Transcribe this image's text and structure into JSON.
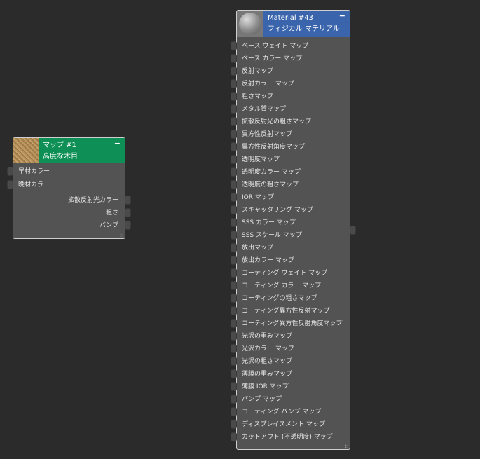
{
  "map_node": {
    "title": "マップ #1",
    "subtitle": "高度な木目",
    "color": "#0e8f55",
    "inputs": [
      "早材カラー",
      "晩材カラー"
    ],
    "outputs": [
      "拡散反射光カラー",
      "粗さ",
      "バンプ"
    ]
  },
  "material_node": {
    "title": "Material #43",
    "subtitle": "フィジカル マテリアル",
    "color": "#3a64ab",
    "inputs": [
      "ベース ウェイト マップ",
      "ベース カラー マップ",
      "反射マップ",
      "反射カラー マップ",
      "粗さマップ",
      "メタル質マップ",
      "拡散反射光の粗さマップ",
      "異方性反射マップ",
      "異方性反射角度マップ",
      "透明度マップ",
      "透明度カラー マップ",
      "透明度の粗さマップ",
      "IOR マップ",
      "スキャッタリング マップ",
      "SSS カラー マップ",
      "SSS スケール マップ",
      "放出マップ",
      "放出カラー マップ",
      "コーティング ウェイト マップ",
      "コーティング カラー マップ",
      "コーティングの粗さマップ",
      "コーティング異方性反射マップ",
      "コーティング異方性反射角度マップ",
      "光沢の重みマップ",
      "光沢カラー マップ",
      "光沢の粗さマップ",
      "薄膜の重みマップ",
      "薄膜 IOR マップ",
      "バンプ マップ",
      "コーティング バンプ マップ",
      "ディスプレイスメント マップ",
      "カットアウト (不透明度) マップ"
    ]
  },
  "minimize_label": "−"
}
